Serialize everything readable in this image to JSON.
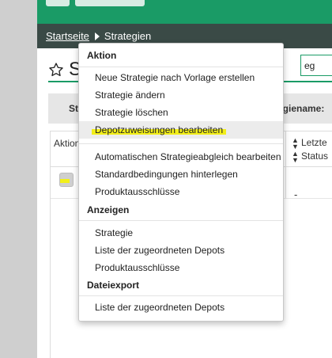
{
  "breadcrumb": {
    "home": "Startseite",
    "current": "Strategien"
  },
  "page": {
    "title_partial": "S",
    "button_partial": "eg",
    "filter_left": "St",
    "filter_right": "egiename:"
  },
  "table": {
    "col_aktion": "Aktion",
    "col_right_1": "Letzte",
    "col_right_2": "Status",
    "row_value": "-"
  },
  "dropdown": {
    "sections": [
      {
        "title": "Aktion",
        "items": [
          "Neue Strategie nach Vorlage erstellen",
          "Strategie ändern",
          "Strategie löschen",
          "Depotzuweisungen bearbeiten",
          "Automatischen Strategieabgleich bearbeiten",
          "Standardbedingungen hinterlegen",
          "Produktausschlüsse"
        ]
      },
      {
        "title": "Anzeigen",
        "items": [
          "Strategie",
          "Liste der zugeordneten Depots",
          "Produktausschlüsse"
        ]
      },
      {
        "title": "Dateiexport",
        "items": [
          "Liste der zugeordneten Depots"
        ]
      }
    ]
  },
  "colors": {
    "brand_green": "#1a9b66",
    "highlight": "#f2ee19"
  },
  "icons": {
    "title": "star-outline-icon",
    "breadcrumb_separator": "triangle-right-icon",
    "sort": "sort-icon"
  }
}
